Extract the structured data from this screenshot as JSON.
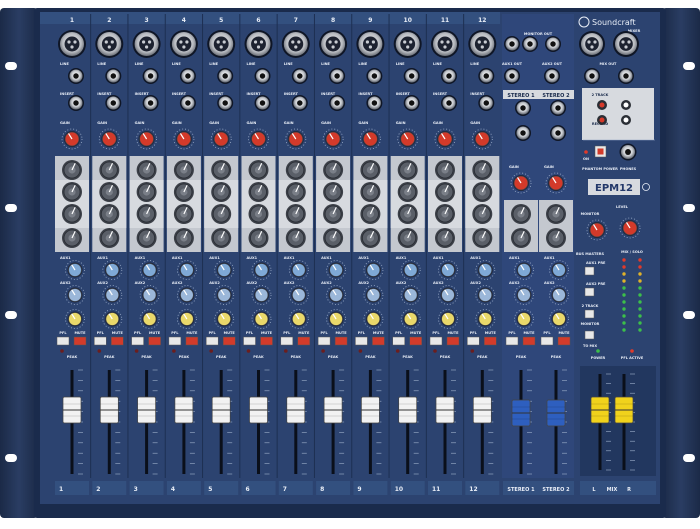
{
  "brand": "Soundcraft",
  "brand_sub": "MIXER",
  "model": "EPM12",
  "channels": [
    "1",
    "2",
    "3",
    "4",
    "5",
    "6",
    "7",
    "8",
    "9",
    "10",
    "11",
    "12"
  ],
  "stereo_channels": [
    "STEREO 1",
    "STEREO 2"
  ],
  "mix_labels": {
    "main": "MIX",
    "left": "L",
    "right": "R"
  },
  "labels": {
    "line": "LINE",
    "insert": "INSERT",
    "gain": "GAIN",
    "aux1": "AUX1",
    "aux2": "AUX2",
    "pfl": "PFL",
    "mute": "MUTE",
    "peak": "PEAK",
    "monitor_out": "MONITOR OUT",
    "aux1_out": "AUX1 OUT",
    "aux2_out": "AUX2 OUT",
    "mix_out": "MIX OUT",
    "two_track": "2 TRACK",
    "record": "RECORD",
    "phantom_power": "PHANTOM POWER",
    "phones": "PHONES",
    "monitor": "MONITOR",
    "level": "LEVEL",
    "bus_masters": "BUS MASTERS",
    "aux1_pre": "AUX1 PRE",
    "aux2_pre": "AUX2 PRE",
    "two_track_ret": "2 TRACK",
    "to_mix": "TO MIX",
    "power": "POWER",
    "pfl_active": "PFL ACTIVE",
    "mix_solo": "MIX / SOLO",
    "on": "ON"
  },
  "colors": {
    "panel": "#2c4370",
    "frame": "#14213d",
    "gain_knob": "#d33a2a",
    "aux1_knob": "#7fa9d6",
    "aux2_knob": "#9bb7d9",
    "pan_knob": "#e9d86a",
    "eq_strip": "#c9ccd2",
    "fader_channel": "#f2f2f2",
    "fader_stereo": "#2e5fbf",
    "fader_master": "#f0d21c",
    "mute_button": "#d23b2b",
    "led_green": "#3cbf4a",
    "led_red": "#e03a2a"
  }
}
